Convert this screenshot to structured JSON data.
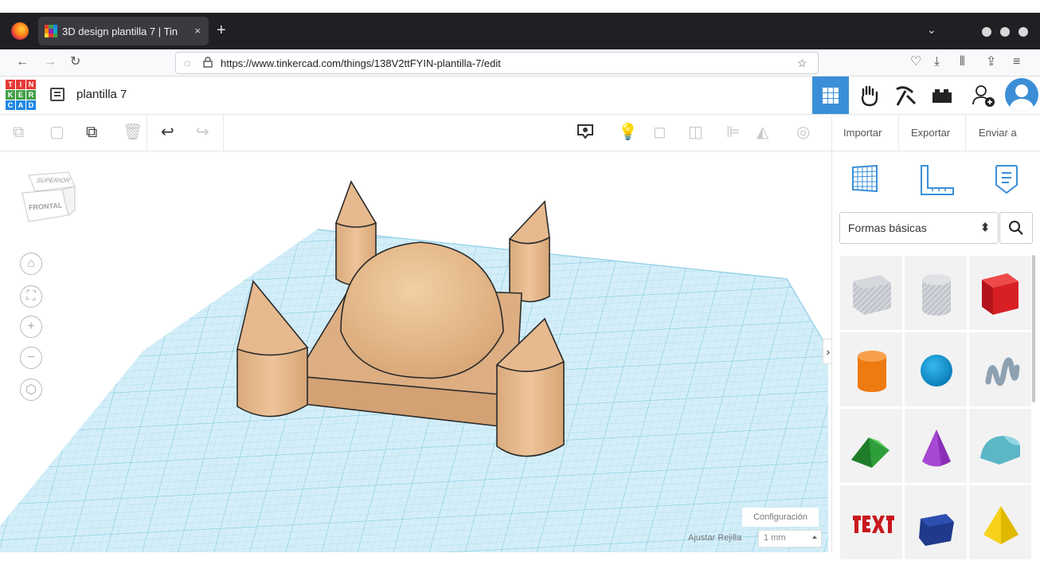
{
  "browser": {
    "tab_title": "3D design plantilla 7 | Tin",
    "tab_close": "×",
    "new_tab": "+",
    "url": "https://www.tinkercad.com/things/138V2ttFYIN-plantilla-7/edit"
  },
  "app": {
    "logo_letters": [
      "T",
      "I",
      "N",
      "K",
      "E",
      "R",
      "C",
      "A",
      "D"
    ],
    "project_name": "plantilla 7"
  },
  "toolbar": {
    "import_label": "Importar",
    "export_label": "Exportar",
    "send_label": "Enviar a"
  },
  "viewcube": {
    "top_face": "SUPERIOR",
    "front_face": "FRONTAL"
  },
  "workplane": {
    "settings_label": "Configuración",
    "snap_label": "Ajustar Rejilla",
    "snap_value": "1 mm"
  },
  "panel": {
    "category": "Formas básicas",
    "collapse": "›",
    "shapes": [
      "box-hole",
      "cylinder-hole",
      "box",
      "cylinder",
      "sphere",
      "scribble",
      "roof",
      "cone",
      "round-roof",
      "text",
      "prism",
      "pyramid"
    ]
  },
  "colors": {
    "accent": "#3a8fd8",
    "shape_tan": "#e6b98e",
    "grid_blue": "#c9ebf6",
    "tab_bar": "#1f1f24"
  }
}
